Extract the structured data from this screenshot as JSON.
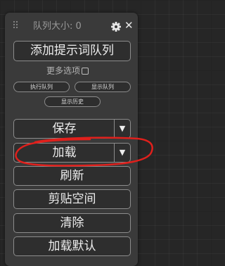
{
  "panel": {
    "queue_size_label": "队列大小: 0",
    "add_prompt_queue_label": "添加提示词队列",
    "more_options_label": "更多选项",
    "more_options_checked": false,
    "small_buttons": [
      "执行队列",
      "显示队列",
      "显示历史"
    ],
    "buttons": {
      "save": "保存",
      "load": "加载",
      "refresh": "刷新",
      "clipspace": "剪贴空间",
      "clear": "清除",
      "load_default": "加载默认"
    },
    "dropdown_arrow": "▼"
  },
  "icons": {
    "drag": "drag-handle-icon",
    "settings": "gear-icon",
    "close": "close-icon",
    "close_glyph": "✕"
  },
  "colors": {
    "annotation": "#e0201c",
    "panel_bg": "#3a3a3a",
    "button_bg": "#2e2e2e"
  }
}
